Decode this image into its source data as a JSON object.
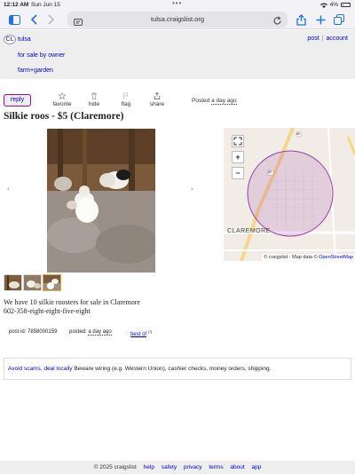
{
  "status_bar": {
    "time": "12:12 AM",
    "date": "Sun Jun 15",
    "battery": "4%"
  },
  "browser": {
    "url": "tulsa.craigslist.org"
  },
  "header": {
    "logo": "CL",
    "breadcrumbs": [
      "tulsa",
      "for sale by owner",
      "farm+garden"
    ],
    "post": "post",
    "account": "account"
  },
  "actions": {
    "reply": "reply",
    "favorite": "favorite",
    "hide": "hide",
    "flag": "flag",
    "share": "share",
    "posted_label": "Posted",
    "posted_value": "a day ago"
  },
  "listing": {
    "title": "Silkie roos - $5 (Claremore)",
    "body_line1": "We have 10 silkie roosters for sale in Claremore",
    "body_line2": "602-358-eight-eight-five-eight",
    "post_id_label": "post id:",
    "post_id": "7858000159",
    "posted_label": "posted:",
    "posted_value": "a day ago",
    "best_of": "best of",
    "best_of_sup": "[?]"
  },
  "map": {
    "city_label": "CLAREMORE",
    "attribution_prefix": "© craigslist - Map data ©",
    "attribution_link": "OpenStreetMap",
    "road_shield_1": "66",
    "road_shield_2": "88"
  },
  "scam_notice": {
    "link": "Avoid scams, deal locally",
    "text": "Beware wiring (e.g. Western Union), cashier checks, money orders, shipping."
  },
  "footer": {
    "copyright": "© 2025 craigslist",
    "links": [
      "help",
      "safety",
      "privacy",
      "terms",
      "about",
      "app"
    ]
  }
}
